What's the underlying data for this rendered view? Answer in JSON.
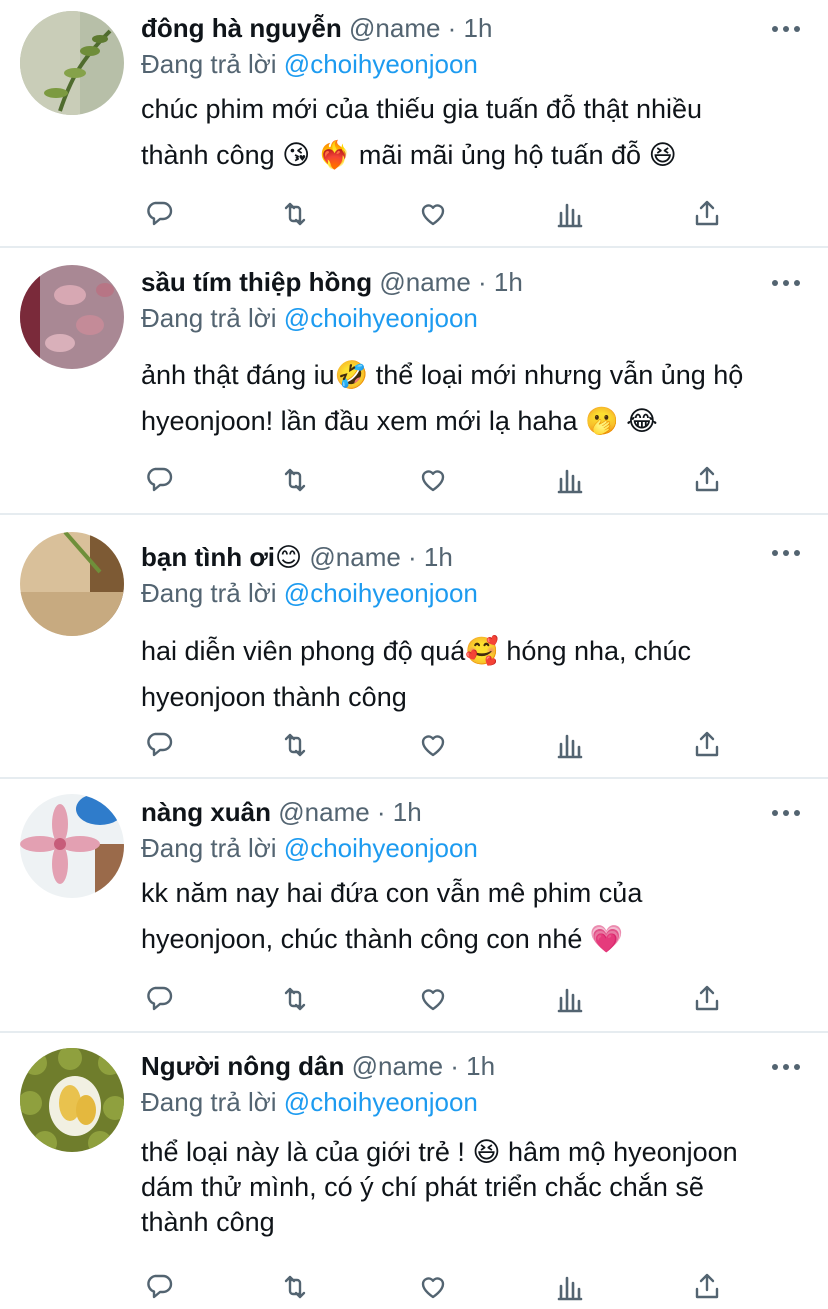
{
  "tweets": [
    {
      "display_name": "đông hà nguyễn",
      "meta": "@name · 1h",
      "reply_prefix": "Đang trả lời",
      "reply_handle": "@choihyeonjoon",
      "lines": [
        "chúc phim mới của thiếu gia tuấn đỗ thật nhiều",
        "thành công 😘 ❤️‍🔥  mãi mãi ủng hộ tuấn đỗ 😆"
      ],
      "avatar_colors": [
        "#8a9b70",
        "#c9cdb8",
        "#4f6b2e"
      ]
    },
    {
      "display_name": "sầu tím thiệp hồng",
      "meta": "@name · 1h",
      "reply_prefix": "Đang trả lời",
      "reply_handle": "@choihyeonjoon",
      "lines": [
        "ảnh thật đáng iu🤣  thể loại mới nhưng vẫn ủng hộ",
        "hyeonjoon! lần đầu xem mới lạ haha 🫢 😂"
      ],
      "avatar_colors": [
        "#9b6a7a",
        "#c08a98",
        "#7a2a3a"
      ]
    },
    {
      "display_name": "bạn tình ơi😊",
      "meta": "@name · 1h",
      "reply_prefix": "Đang trả lời",
      "reply_handle": "@choihyeonjoon",
      "lines": [
        "hai diễn viên phong độ quá🥰  hóng nha, chúc",
        "hyeonjoon thành công"
      ],
      "avatar_colors": [
        "#c9a97a",
        "#e2cfae",
        "#7d5a34"
      ]
    },
    {
      "display_name": "nàng xuân",
      "meta": "@name · 1h",
      "reply_prefix": "Đang trả lời",
      "reply_handle": "@choihyeonjoon",
      "lines": [
        "kk năm nay hai đứa con vẫn mê phim của",
        "hyeonjoon, chúc thành công con nhé 💗"
      ],
      "avatar_colors": [
        "#d8a2b0",
        "#e9eef2",
        "#2f7ccb"
      ]
    },
    {
      "display_name": "Người nông dân",
      "meta": "@name · 1h",
      "reply_prefix": "Đang trả lời",
      "reply_handle": "@choihyeonjoon",
      "lines": [
        "thể loại này là của giới trẻ ! 😆  hâm mộ hyeonjoon",
        "dám thử mình, có ý chí phát triển chắc chắn sẽ",
        "thành công"
      ],
      "avatar_colors": [
        "#8a9a3a",
        "#e8c85a",
        "#4f5a22"
      ]
    }
  ],
  "colors": {
    "text": "#0f1419",
    "secondary": "#536471",
    "link": "#1d9bf0",
    "divider": "#e6ecf0"
  },
  "action_icons": [
    "reply-icon",
    "retweet-icon",
    "like-icon",
    "views-icon",
    "share-icon"
  ]
}
